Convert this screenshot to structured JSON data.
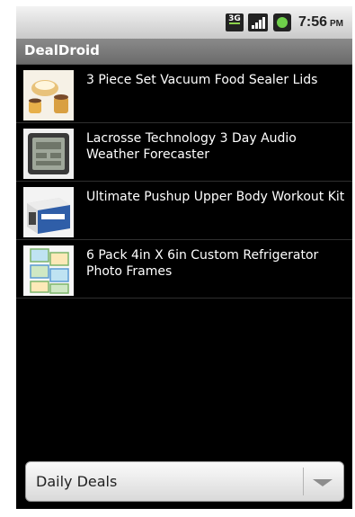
{
  "status_bar": {
    "network_label": "3G",
    "time": "7:56",
    "ampm": "PM",
    "icons": [
      "3g-icon",
      "signal-icon",
      "battery-icon"
    ]
  },
  "app": {
    "title": "DealDroid"
  },
  "deals": [
    {
      "label": "3 Piece Set Vacuum Food Sealer Lids",
      "thumbnail": "food-sealer-lids-thumbnail"
    },
    {
      "label": "Lacrosse Technology 3 Day Audio Weather Forecaster",
      "thumbnail": "weather-forecaster-thumbnail"
    },
    {
      "label": "Ultimate Pushup Upper Body Workout Kit",
      "thumbnail": "pushup-kit-thumbnail"
    },
    {
      "label": "6 Pack 4in X 6in Custom Refrigerator Photo Frames",
      "thumbnail": "photo-frames-thumbnail"
    }
  ],
  "spinner": {
    "selected": "Daily Deals"
  },
  "colors": {
    "background": "#000000",
    "title_bar": "#7a7a7a",
    "status_bar": "#dcdcdc",
    "list_text": "#ffffff",
    "divider": "#2f2f2f"
  }
}
